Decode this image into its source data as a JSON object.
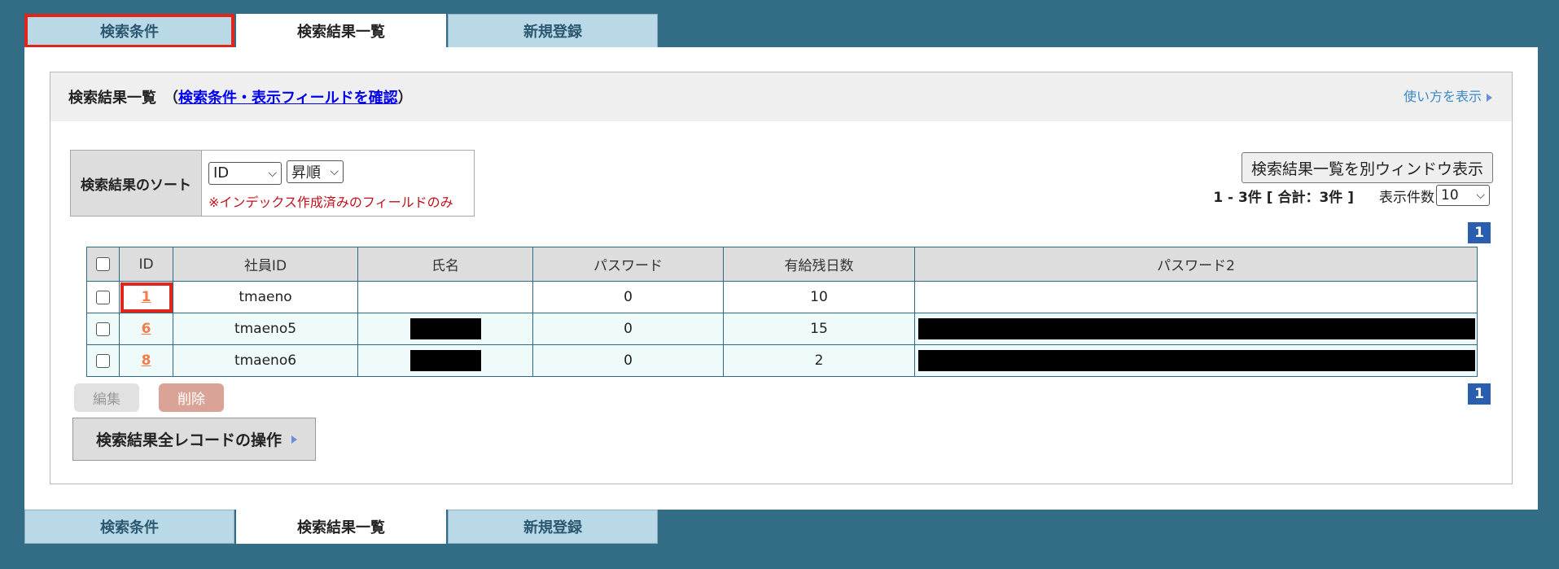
{
  "tabs": [
    {
      "label": "検索条件"
    },
    {
      "label": "検索結果一覧"
    },
    {
      "label": "新規登録"
    }
  ],
  "header": {
    "title_prefix": "検索結果一覧　（",
    "title_link": "検索条件・表示フィールドを確認",
    "title_suffix": "）",
    "howto": "使い方を表示"
  },
  "sort": {
    "label": "検索結果のソート",
    "field_value": "ID",
    "order_value": "昇順",
    "note": "※インデックス作成済みのフィールドのみ"
  },
  "toolbar": {
    "separate_window": "検索結果一覧を別ウィンドウ表示",
    "counts": "1 - 3件 [ 合計：3件 ]",
    "per_page_label": "表示件数",
    "per_page_value": "10"
  },
  "pager": {
    "page": "1"
  },
  "table": {
    "headers": [
      "ID",
      "社員ID",
      "氏名",
      "パスワード",
      "有給残日数",
      "パスワード2"
    ],
    "rows": [
      {
        "id": "1",
        "employee_id": "tmaeno",
        "name": "",
        "password": "0",
        "paid_leave": "10",
        "password2": ""
      },
      {
        "id": "6",
        "employee_id": "tmaeno5",
        "name": "",
        "password": "0",
        "paid_leave": "15",
        "password2": ""
      },
      {
        "id": "8",
        "employee_id": "tmaeno6",
        "name": "",
        "password": "0",
        "paid_leave": "2",
        "password2": ""
      }
    ]
  },
  "actions": {
    "edit": "編集",
    "delete": "削除",
    "all_records": "検索結果全レコードの操作"
  },
  "colors": {
    "background": "#336d85",
    "tab_inactive": "#b9d9e7",
    "highlight": "#e0251b",
    "link": "#0000ee",
    "id_link": "#f27c4a",
    "pager": "#2a5fb0"
  }
}
